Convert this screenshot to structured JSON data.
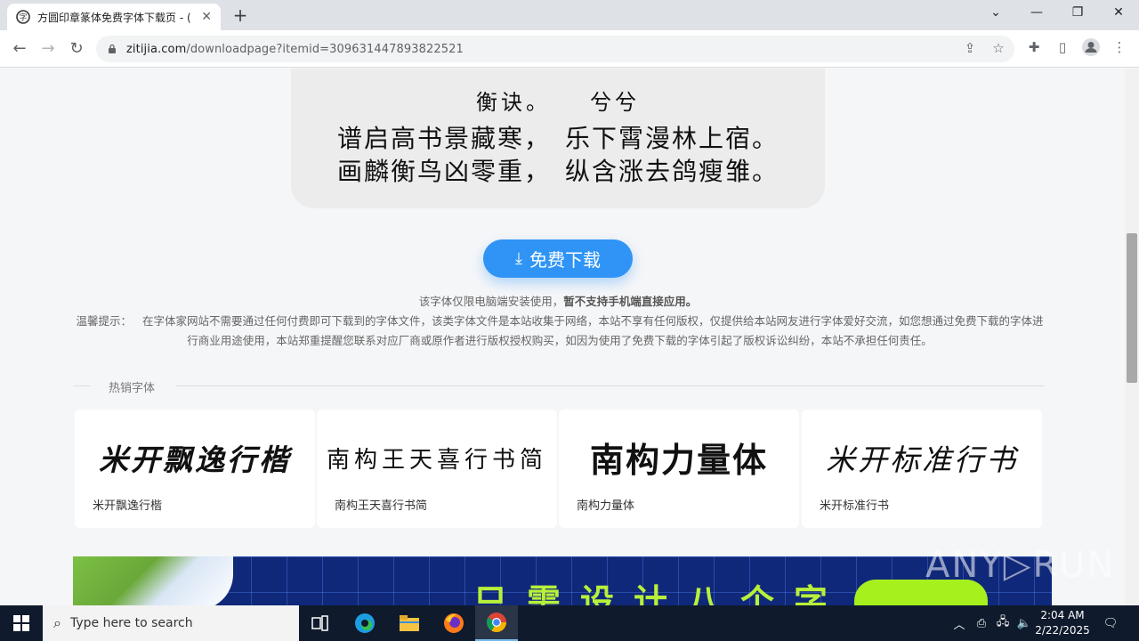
{
  "browser": {
    "tab_title": "方圆印章篆体免费字体下载页 - (",
    "url_domain": "zitijia.com",
    "url_path": "/downloadpage?itemid=309631447893822521"
  },
  "preview": {
    "line1": "衡诀。　　兮兮",
    "line2": "谱启高书景藏寒，　乐下霄漫林上宿。",
    "line3": "画麟衡鸟凶零重，　纵含涨去鸽瘦雏。"
  },
  "download": {
    "label": "免费下载"
  },
  "notice": {
    "line1_normal": "该字体仅限电脑端安装使用，",
    "line1_bold": "暂不支持手机端直接应用。",
    "tip_label": "温馨提示：",
    "tip_text": "在字体家网站不需要通过任何付费即可下载到的字体文件，该类字体文件是本站收集于网络，本站不享有任何版权，仅提供给本站网友进行字体爱好交流，如您想通过免费下载的字体进行商业用途使用，本站郑重提醒您联系对应厂商或原作者进行版权授权购买，如因为使用了免费下载的字体引起了版权诉讼纠纷，本站不承担任何责任。"
  },
  "hot": {
    "section_title": "热销字体",
    "cards": [
      {
        "sample": "米开飘逸行楷",
        "name": "米开飘逸行楷"
      },
      {
        "sample": "南构王天喜行书简",
        "name": "南构王天喜行书简"
      },
      {
        "sample": "南构力量体",
        "name": "南构力量体"
      },
      {
        "sample": "米开标准行书",
        "name": "米开标准行书"
      }
    ]
  },
  "banner": {
    "slogan": "只需设计八个字"
  },
  "watermark": "ANY▷RUN",
  "taskbar": {
    "search_placeholder": "Type here to search",
    "time": "2:04 AM",
    "date": "2/22/2025"
  },
  "colors": {
    "accent": "#2f94f5",
    "taskbar": "#0f1a2c"
  }
}
